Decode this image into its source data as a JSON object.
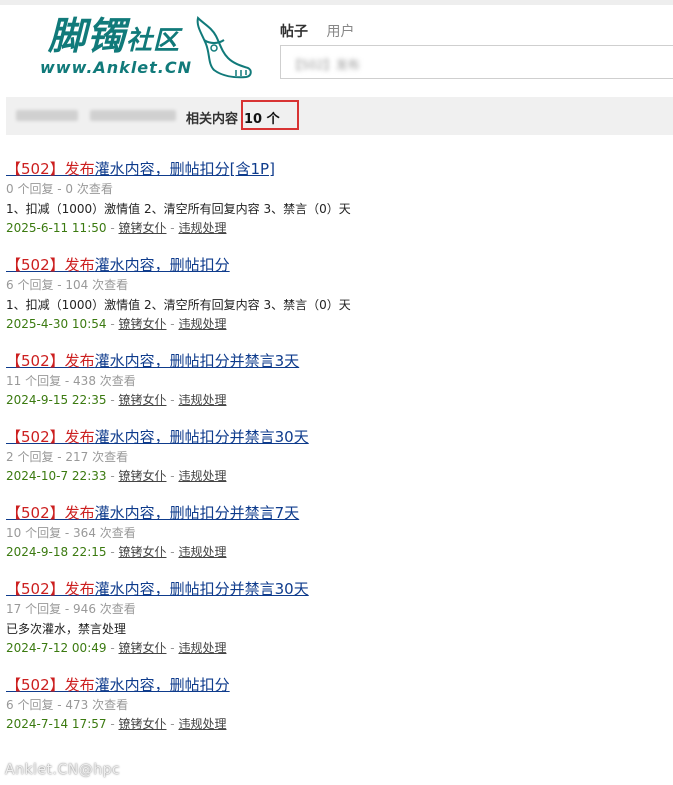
{
  "logo": {
    "name_cn": "脚镯",
    "name_cn_small": "社区",
    "url": "www.Anklet.CN"
  },
  "tabs": [
    {
      "label": "帖子",
      "active": true
    },
    {
      "label": "用户",
      "active": false
    }
  ],
  "search": {
    "value": "【502】发布"
  },
  "breadcrumb": {
    "label": "相关内容",
    "count": "10 个"
  },
  "results": [
    {
      "kw": "【502】发布",
      "rest": "灌水内容，删帖扣分[含1P]",
      "meta": "0 个回复 - 0 次查看",
      "desc": "1、扣减（1000）激情值 2、清空所有回复内容 3、禁言（0）天",
      "date": "2025-6-11 11:50",
      "author": "镣铐女仆",
      "board": "违规处理"
    },
    {
      "kw": "【502】发布",
      "rest": "灌水内容，删帖扣分",
      "meta": "6 个回复 - 104 次查看",
      "desc": "1、扣减（1000）激情值 2、清空所有回复内容 3、禁言（0）天",
      "date": "2025-4-30 10:54",
      "author": "镣铐女仆",
      "board": "违规处理"
    },
    {
      "kw": "【502】发布",
      "rest": "灌水内容，删帖扣分并禁言3天",
      "meta": "11 个回复 - 438 次查看",
      "desc": "",
      "date": "2024-9-15 22:35",
      "author": "镣铐女仆",
      "board": "违规处理"
    },
    {
      "kw": "【502】发布",
      "rest": "灌水内容，删帖扣分并禁言30天",
      "meta": "2 个回复 - 217 次查看",
      "desc": "",
      "date": "2024-10-7 22:33",
      "author": "镣铐女仆",
      "board": "违规处理"
    },
    {
      "kw": "【502】发布",
      "rest": "灌水内容，删帖扣分并禁言7天",
      "meta": "10 个回复 - 364 次查看",
      "desc": "",
      "date": "2024-9-18 22:15",
      "author": "镣铐女仆",
      "board": "违规处理"
    },
    {
      "kw": "【502】发布",
      "rest": "灌水内容，删帖扣分并禁言30天",
      "meta": "17 个回复 - 946 次查看",
      "desc": "已多次灌水，禁言处理",
      "date": "2024-7-12 00:49",
      "author": "镣铐女仆",
      "board": "违规处理"
    },
    {
      "kw": "【502】发布",
      "rest": "灌水内容，删帖扣分",
      "meta": "6 个回复 - 473 次查看",
      "desc": "",
      "date": "2024-7-14 17:57",
      "author": "镣铐女仆",
      "board": "违规处理"
    }
  ],
  "watermark": "Anklet.CN@hpc",
  "colors": {
    "logo": "#117a7a",
    "keyword": "#cc1f1f",
    "title": "#0e3b8c",
    "date": "#3b7a10",
    "highlight_box": "#d83333"
  }
}
